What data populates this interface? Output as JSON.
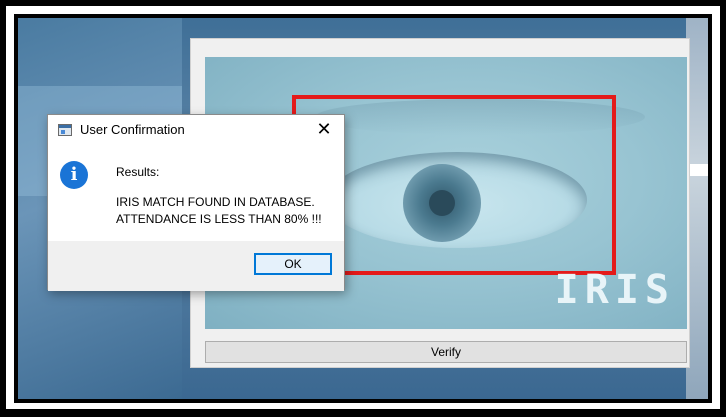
{
  "dialog": {
    "title": "User Confirmation",
    "close_glyph": "✕",
    "icon": "info-icon",
    "heading": "Results:",
    "message_lines": [
      "IRIS MATCH FOUND IN DATABASE.",
      "ATTENDANCE IS LESS THAN 80% !!!"
    ],
    "ok_label": "OK"
  },
  "app": {
    "image_overlay_text": "IRIS",
    "verify_label": "Verify"
  },
  "colors": {
    "detection_box": "#e41a1a",
    "info_icon": "#1a74d6",
    "ok_border": "#0078d7"
  }
}
